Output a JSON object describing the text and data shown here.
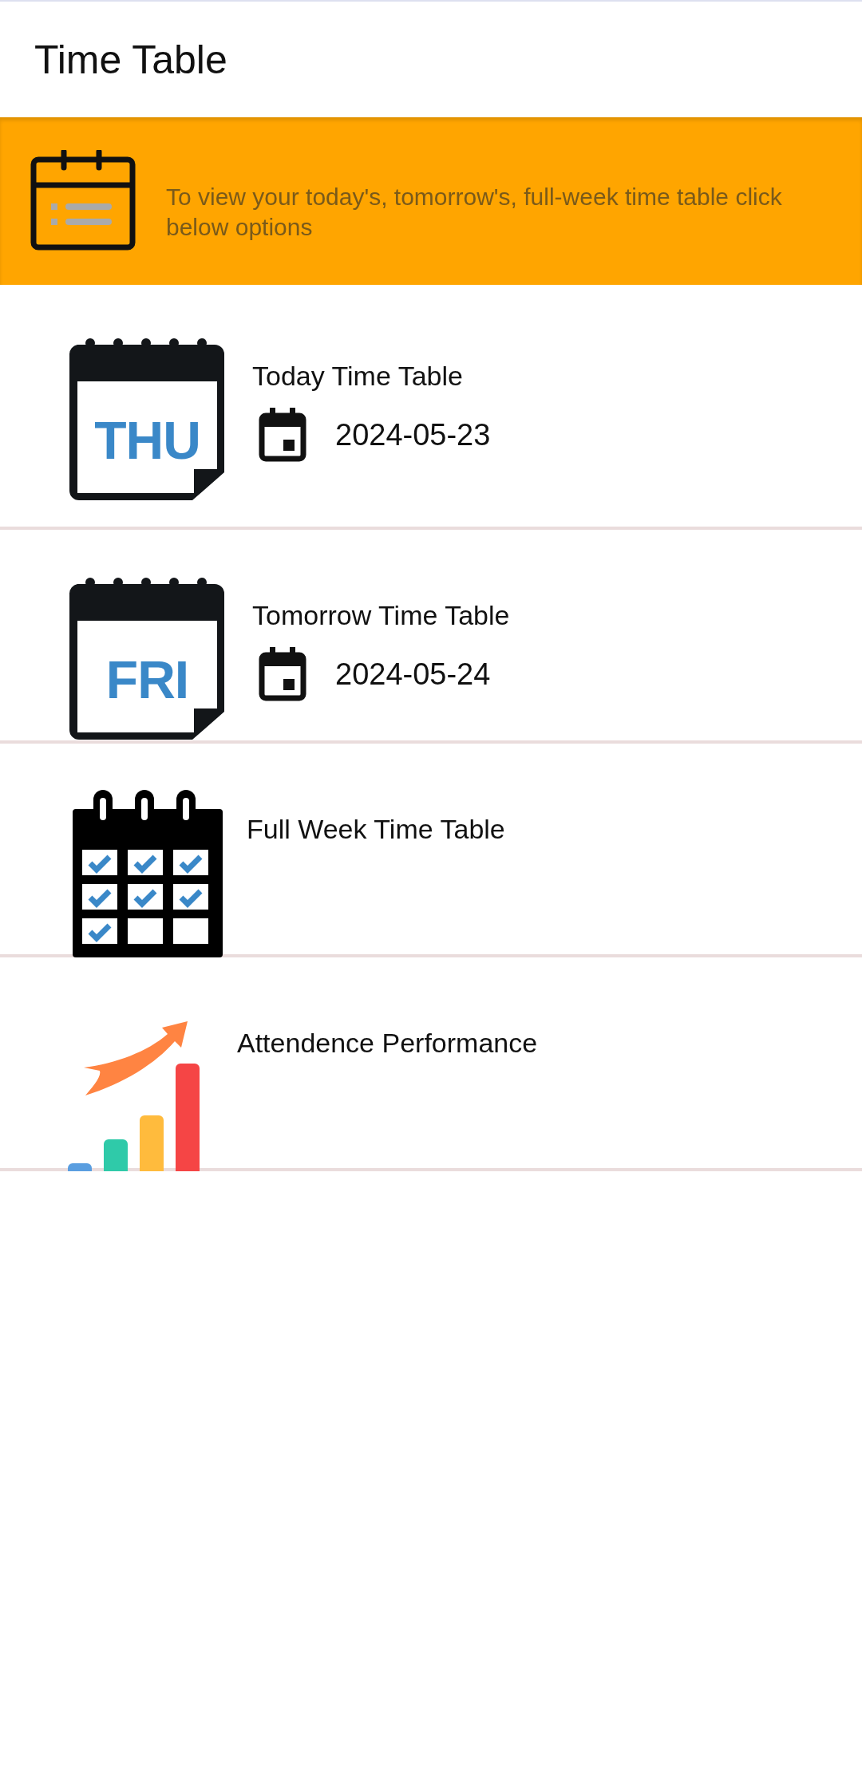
{
  "app_bar": {
    "title": "Time Table"
  },
  "banner": {
    "text": "To view your today's, tomorrow's, full-week time table click below options"
  },
  "items": [
    {
      "kind": "day",
      "day_label": "THU",
      "title": "Today Time Table",
      "date": "2024-05-23"
    },
    {
      "kind": "day",
      "day_label": "FRI",
      "title": "Tomorrow Time Table",
      "date": "2024-05-24"
    },
    {
      "kind": "week",
      "title": "Full Week Time Table"
    },
    {
      "kind": "performance",
      "title": "Attendence Performance"
    }
  ]
}
